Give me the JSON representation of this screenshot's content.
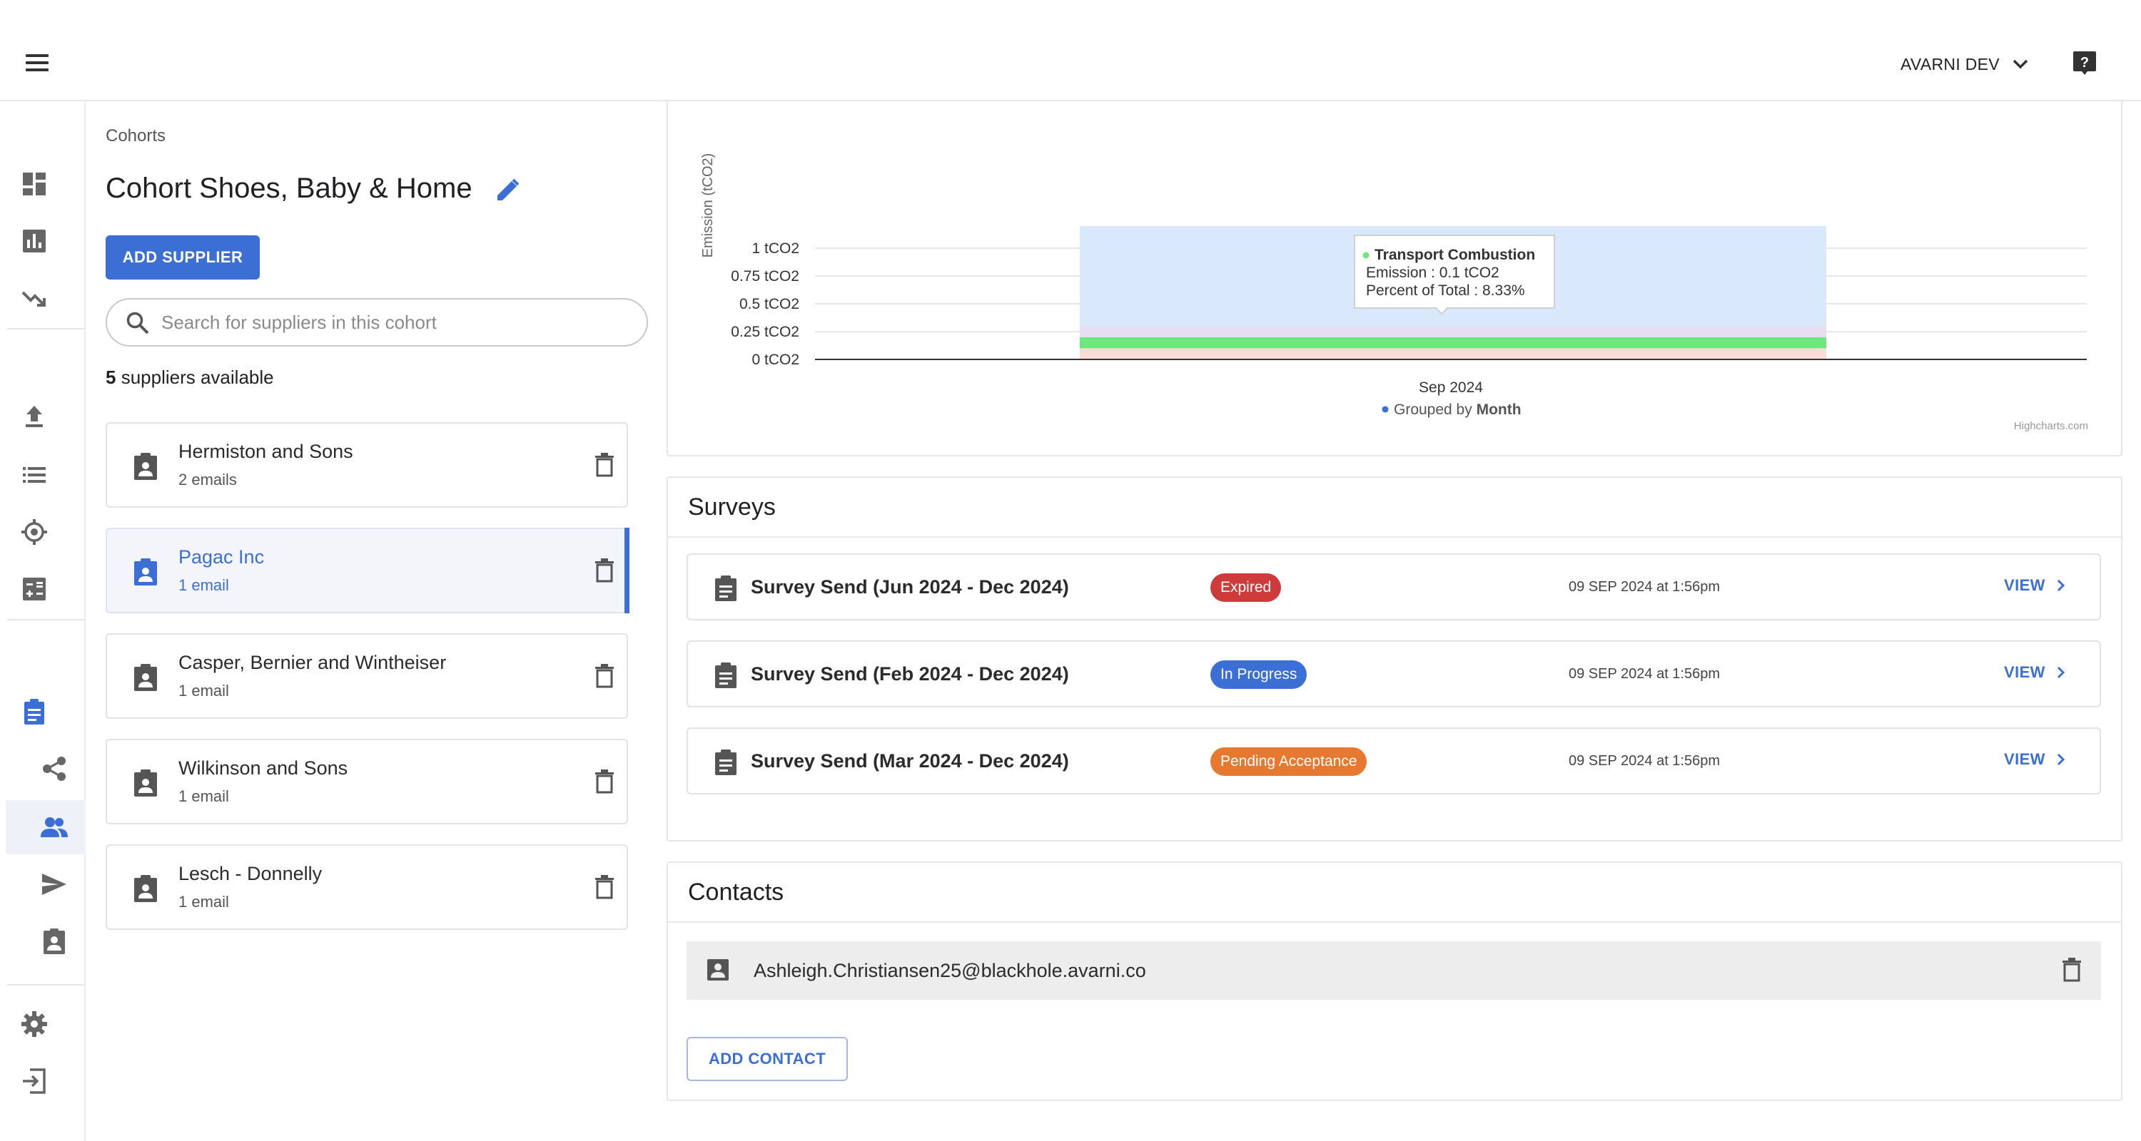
{
  "header": {
    "account_label": "AVARNI DEV"
  },
  "cohort": {
    "breadcrumb": "Cohorts",
    "title": "Cohort Shoes, Baby & Home",
    "add_supplier_label": "ADD SUPPLIER",
    "search_placeholder": "Search for suppliers in this cohort",
    "available_count": "5",
    "available_suffix": " suppliers available",
    "suppliers": [
      {
        "name": "Hermiston and Sons",
        "emails": "2 emails",
        "selected": false
      },
      {
        "name": "Pagac Inc",
        "emails": "1 email",
        "selected": true
      },
      {
        "name": "Casper, Bernier and Wintheiser",
        "emails": "1 email",
        "selected": false
      },
      {
        "name": "Wilkinson and Sons",
        "emails": "1 email",
        "selected": false
      },
      {
        "name": "Lesch - Donnelly",
        "emails": "1 email",
        "selected": false
      }
    ]
  },
  "chart_data": {
    "type": "bar",
    "stacked": true,
    "categories": [
      "Sep 2024"
    ],
    "ylabel": "Emission (tCO2)",
    "y_ticks": [
      "0 tCO2",
      "0.25 tCO2",
      "0.5 tCO2",
      "0.75 tCO2",
      "1 tCO2"
    ],
    "ylim": [
      0,
      1.2
    ],
    "grid": true,
    "series_stack": [
      {
        "value": 0.1,
        "color": "#f9ddd6"
      },
      {
        "value": 0.1,
        "color": "#6ee77f"
      },
      {
        "value": 0.1,
        "color": "#e7dff1"
      },
      {
        "value": 0.9,
        "color": "#d9e9fb"
      }
    ],
    "tooltip": {
      "series": "Transport Combustion",
      "line1": "Emission : 0.1 tCO2",
      "line2": "Percent of Total : 8.33%"
    },
    "grouping_prefix": "Grouped by ",
    "grouping_value": "Month",
    "credit": "Highcharts.com"
  },
  "surveys": {
    "title": "Surveys",
    "items": [
      {
        "name": "Survey Send (Jun 2024 - Dec 2024)",
        "status": "Expired",
        "status_color": "#cf3b3b",
        "date": "09 SEP 2024 at 1:56pm",
        "action": "VIEW"
      },
      {
        "name": "Survey Send (Feb 2024 - Dec 2024)",
        "status": "In Progress",
        "status_color": "#3b6fd6",
        "date": "09 SEP 2024 at 1:56pm",
        "action": "VIEW"
      },
      {
        "name": "Survey Send (Mar 2024 - Dec 2024)",
        "status": "Pending Acceptance",
        "status_color": "#e7782f",
        "date": "09 SEP 2024 at 1:56pm",
        "action": "VIEW"
      }
    ]
  },
  "contacts": {
    "title": "Contacts",
    "items": [
      {
        "email": "Ashleigh.Christiansen25@blackhole.avarni.co"
      }
    ],
    "add_contact_label": "ADD CONTACT"
  }
}
